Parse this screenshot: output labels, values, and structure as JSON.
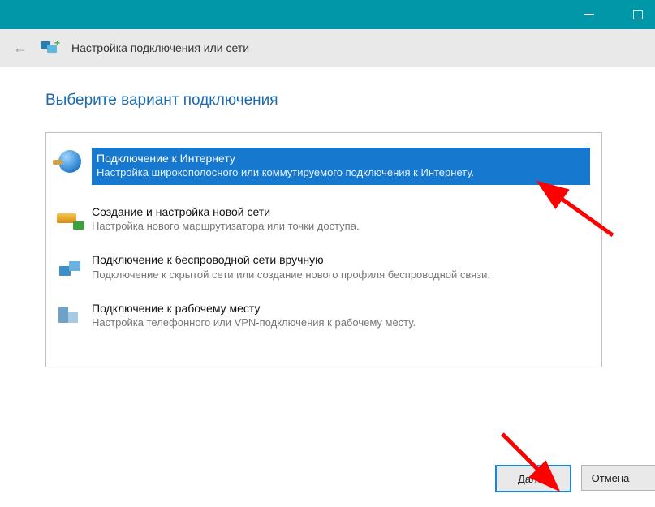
{
  "window": {
    "title": "Настройка подключения или сети"
  },
  "page": {
    "heading": "Выберите вариант подключения"
  },
  "options": [
    {
      "title": "Подключение к Интернету",
      "desc": "Настройка широкополосного или коммутируемого подключения к Интернету.",
      "icon": "globe-icon",
      "selected": true
    },
    {
      "title": "Создание и настройка новой сети",
      "desc": "Настройка нового маршрутизатора или точки доступа.",
      "icon": "router-icon",
      "selected": false
    },
    {
      "title": "Подключение к беспроводной сети вручную",
      "desc": "Подключение к скрытой сети или создание нового профиля беспроводной связи.",
      "icon": "wifi-icon",
      "selected": false
    },
    {
      "title": "Подключение к рабочему месту",
      "desc": "Настройка телефонного или VPN-подключения к рабочему месту.",
      "icon": "workplace-icon",
      "selected": false
    }
  ],
  "buttons": {
    "next": "Далее",
    "cancel": "Отмена"
  }
}
